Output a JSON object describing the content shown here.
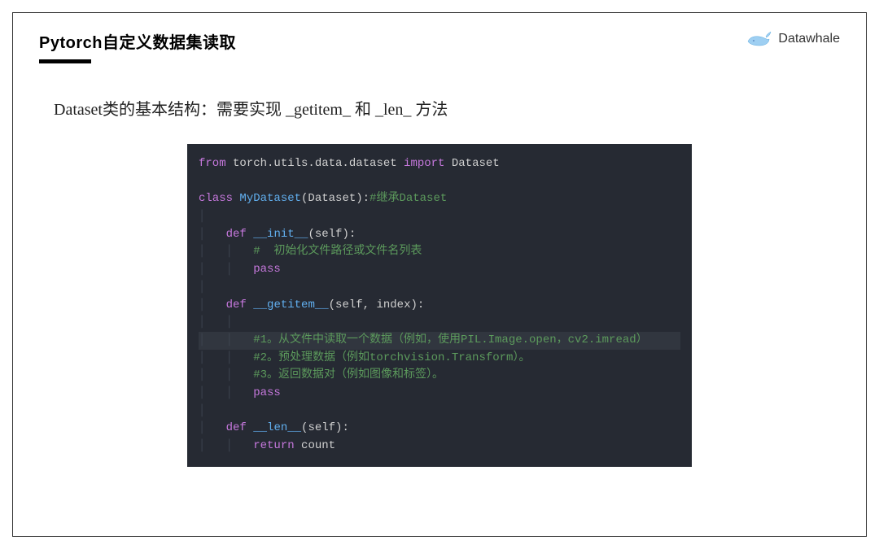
{
  "header": {
    "title": "Pytorch自定义数据集读取",
    "brand": "Datawhale"
  },
  "body": {
    "intro": "Dataset类的基本结构：需要实现 _getitem_ 和 _len_ 方法"
  },
  "code": {
    "l1": {
      "kw1": "from",
      "mod": " torch.utils.data.dataset ",
      "kw2": "import",
      "name": " Dataset"
    },
    "l2": {
      "kw": "class",
      "name": " MyDataset",
      "par": "(Dataset):",
      "cmt": "#继承Dataset"
    },
    "l3": {
      "kw": "def",
      "fn": "__init__",
      "args": "(self):"
    },
    "l4": "#  初始化文件路径或文件名列表",
    "l5": "pass",
    "l6": {
      "kw": "def",
      "fn": "__getitem__",
      "args": "(self, index):"
    },
    "l7": "#1。从文件中读取一个数据（例如，使用PIL.Image.open，cv2.imread）",
    "l8": "#2。预处理数据（例如torchvision.Transform）。",
    "l9": "#3。返回数据对（例如图像和标签）。",
    "l10": "pass",
    "l11": {
      "kw": "def",
      "fn": "__len__",
      "args": "(self):"
    },
    "l12": {
      "kw": "return",
      "val": " count"
    }
  }
}
